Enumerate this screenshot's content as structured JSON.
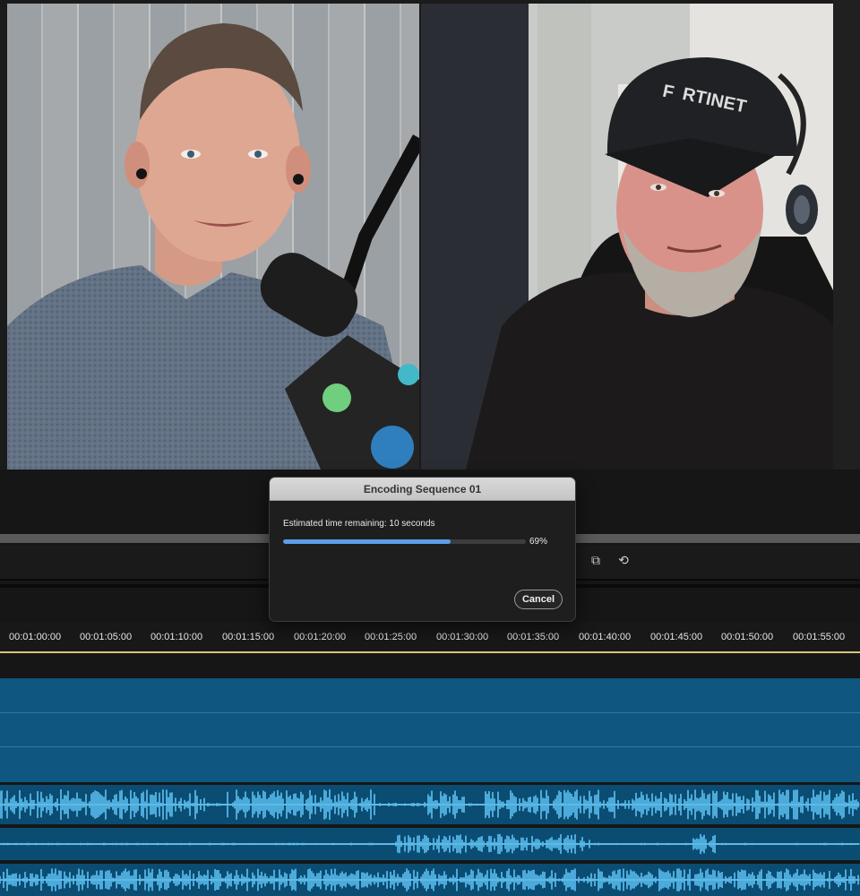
{
  "dialog": {
    "title": "Encoding Sequence 01",
    "status": "Estimated time remaining: 10 seconds",
    "progress": 0.69,
    "progress_label": "69%",
    "cancel_label": "Cancel"
  },
  "timeline": {
    "timecodes": [
      "00:01:00:00",
      "00:01:05:00",
      "00:01:10:00",
      "00:01:15:00",
      "00:01:20:00",
      "00:01:25:00",
      "00:01:30:00",
      "00:01:35:00",
      "00:01:40:00",
      "00:01:45:00",
      "00:01:50:00",
      "00:01:55:00"
    ],
    "track_color": "#0f5680",
    "audio_color": "#0b4c73",
    "waveform_color": "#5cc3f3",
    "playhead_color": "#d8c47a"
  },
  "monitor": {
    "left_video": "Host on camera with microphone",
    "right_video": "Guest on camera with headset"
  },
  "icons": [
    "insert-overwrite-icon",
    "export-frame-icon"
  ]
}
